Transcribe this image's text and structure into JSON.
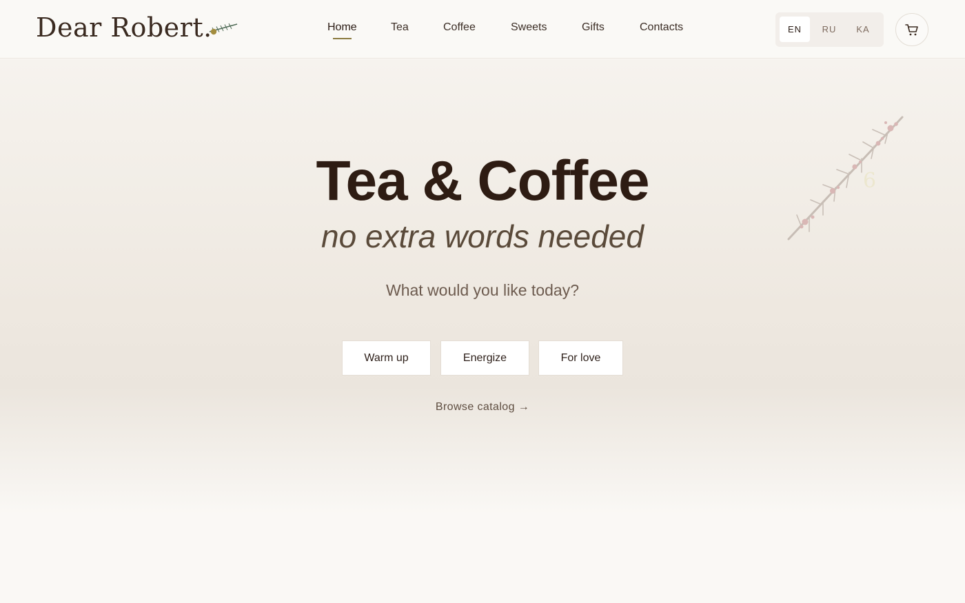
{
  "header": {
    "logo_text": "Dear Robert.",
    "logo_sprig_icon": "pine-sprig-icon",
    "nav": [
      {
        "label": "Home",
        "active": true
      },
      {
        "label": "Tea",
        "active": false
      },
      {
        "label": "Coffee",
        "active": false
      },
      {
        "label": "Sweets",
        "active": false
      },
      {
        "label": "Gifts",
        "active": false
      },
      {
        "label": "Contacts",
        "active": false
      }
    ],
    "languages": [
      {
        "label": "EN",
        "active": true
      },
      {
        "label": "RU",
        "active": false
      },
      {
        "label": "KA",
        "active": false
      }
    ],
    "cart_icon": "cart-icon"
  },
  "hero": {
    "title": "Tea & Coffee",
    "subtitle": "no extra words needed",
    "question": "What would you like today?",
    "moods": [
      "Warm up",
      "Energize",
      "For love"
    ],
    "browse_link": "Browse catalog →",
    "decoration_icon": "blossom-branch-icon"
  },
  "colors": {
    "accent_underline": "#8a7a3e",
    "text_dark": "#2e1c13",
    "hero_bg_top": "#f6f3ee",
    "hero_bg_mid": "#eee8e0",
    "page_bg": "#faf8f5"
  }
}
